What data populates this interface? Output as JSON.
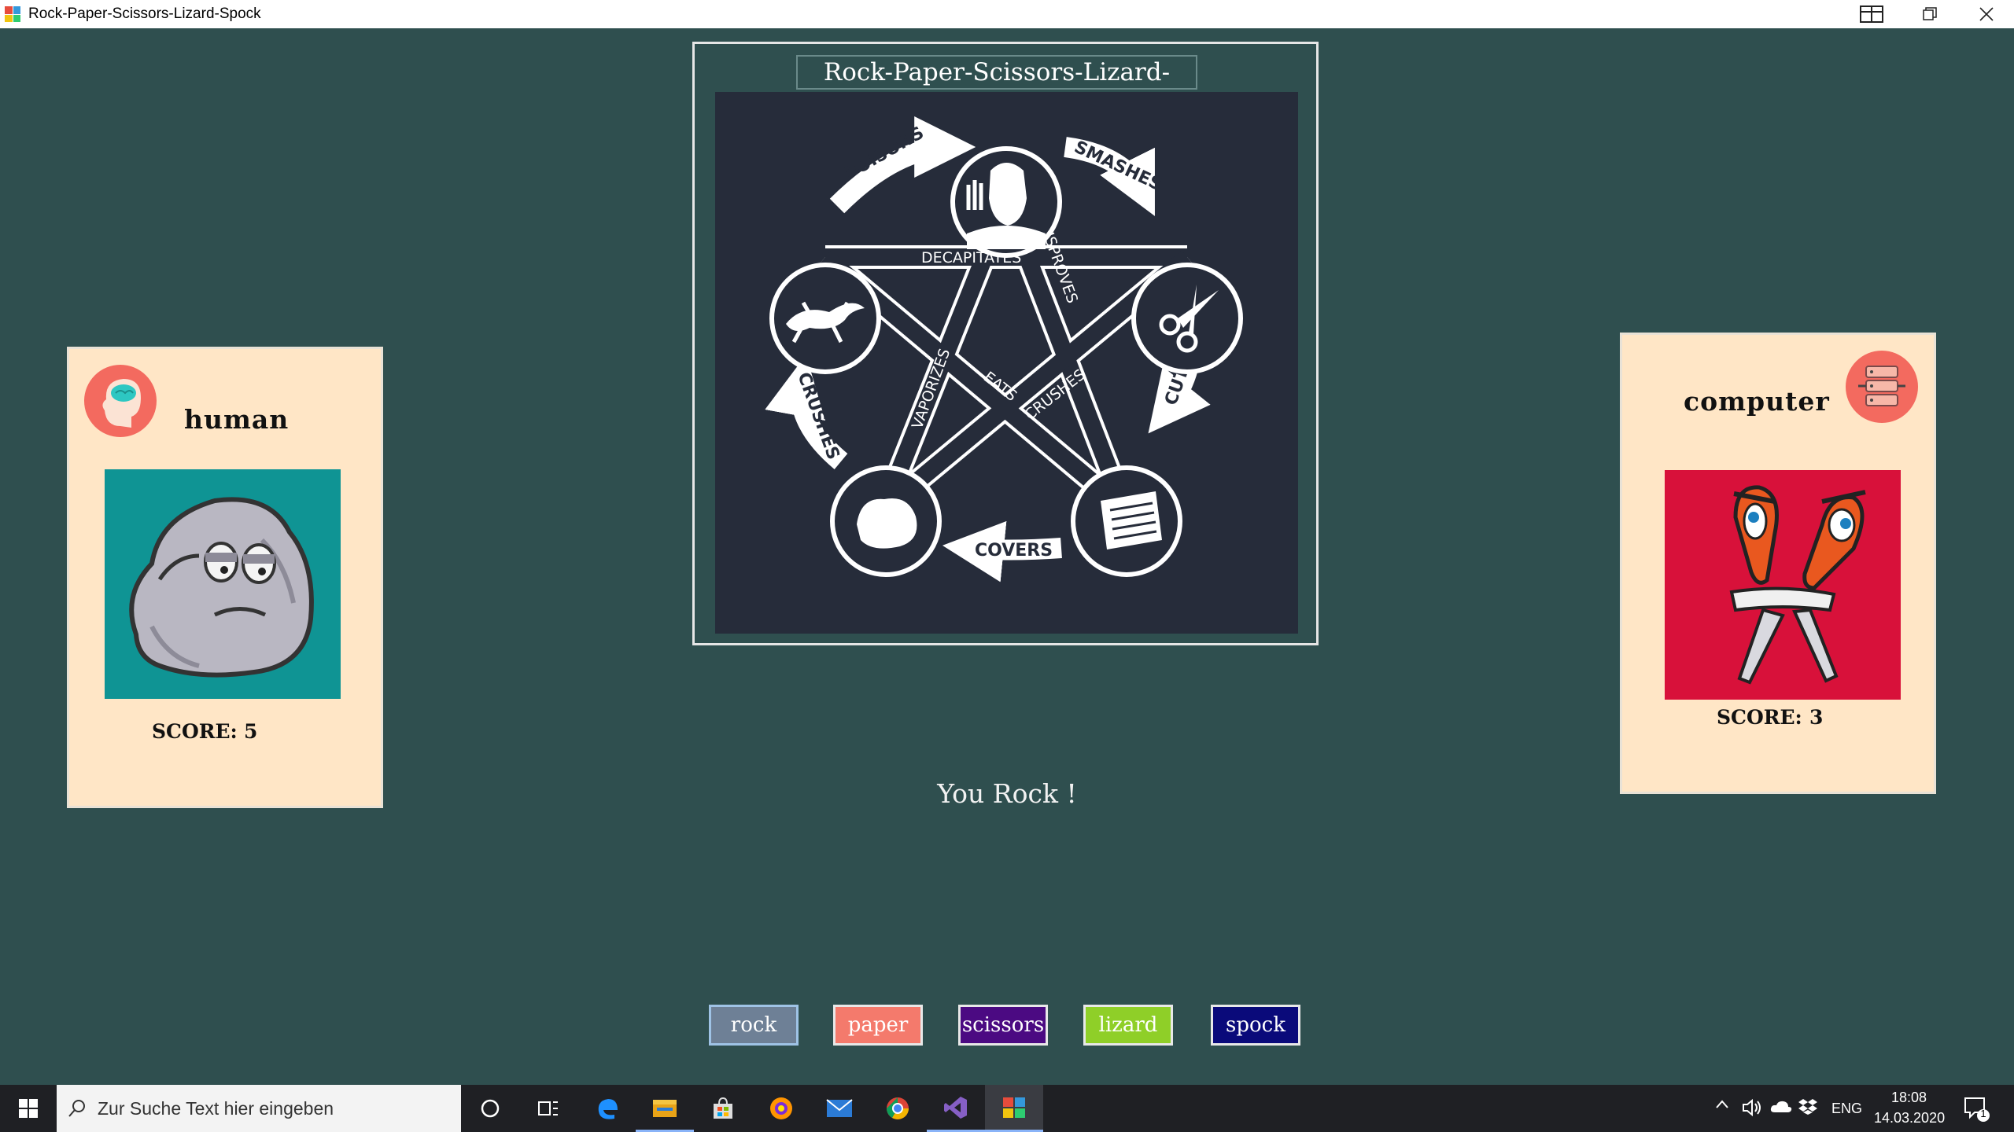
{
  "window": {
    "title": "Rock-Paper-Scissors-Lizard-Spock",
    "controls": [
      "tablet-mode-icon",
      "restore-icon",
      "close-icon"
    ]
  },
  "logo": {
    "title": "Rock-Paper-Scissors-Lizard-Spock",
    "verbs": {
      "poisons": "POISONS",
      "smashes": "SMASHES",
      "cuts": "CUTS",
      "covers": "COVERS",
      "crushes_outer": "CRUSHES",
      "decapitates": "DECAPITATES",
      "disproves": "DISPROVES",
      "vaporizes": "VAPORIZES",
      "eats": "EATS",
      "crushes_inner": "CRUSHES"
    }
  },
  "human": {
    "name": "human",
    "score_label": "SCORE:",
    "score": "5",
    "pick": "rock",
    "avatar_icon": "brain-head-icon",
    "pick_bg": "#0f9494"
  },
  "computer": {
    "name": "computer",
    "score_label": "SCORE:",
    "score": "3",
    "pick": "scissors",
    "avatar_icon": "server-icon",
    "pick_bg": "#d8113a"
  },
  "result": "You Rock !",
  "choices": [
    {
      "label": "rock",
      "color": "#6e8096"
    },
    {
      "label": "paper",
      "color": "#f47a6c"
    },
    {
      "label": "scissors",
      "color": "#4b0a82"
    },
    {
      "label": "lizard",
      "color": "#8fcf28"
    },
    {
      "label": "spock",
      "color": "#0a0a7a"
    }
  ],
  "taskbar": {
    "search_placeholder": "Zur Suche Text hier eingeben",
    "language": "ENG",
    "time": "18:08",
    "date": "14.03.2020",
    "notification_count": "1",
    "apps": [
      "cortana-icon",
      "task-view-icon",
      "edge-icon",
      "file-explorer-icon",
      "store-icon",
      "firefox-icon",
      "mail-icon",
      "chrome-icon",
      "visual-studio-icon",
      "rpsls-app-icon"
    ]
  }
}
